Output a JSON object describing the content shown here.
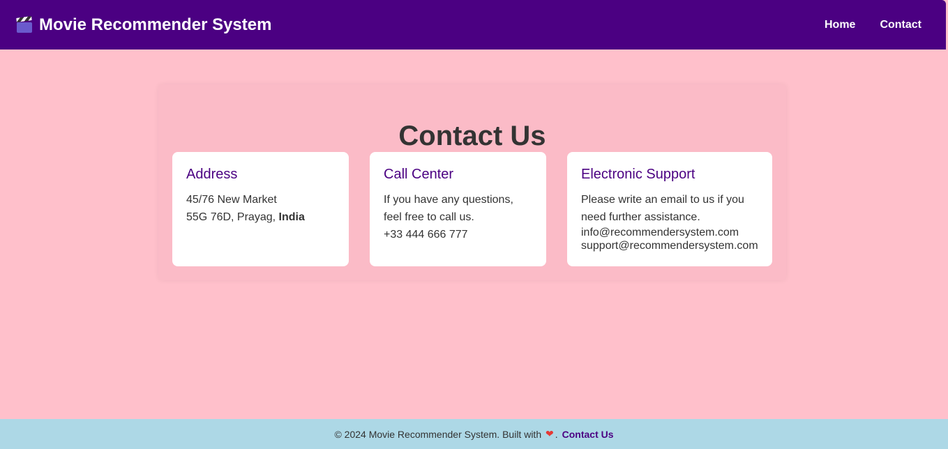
{
  "navbar": {
    "brand_icon": "clapperboard-icon",
    "title": "Movie Recommender System",
    "links": [
      "Home",
      "Contact"
    ]
  },
  "main": {
    "title": "Contact Us",
    "cards": [
      {
        "title": "Address",
        "line1": "45/76 New Market",
        "line2_prefix": "55G 76D, Prayag, ",
        "line2_bold": "India"
      },
      {
        "title": "Call Center",
        "text": "If you have any questions, feel free to call us.",
        "phone": "+33 444 666 777"
      },
      {
        "title": "Electronic Support",
        "text": "Please write an email to us if you need further assistance.",
        "emails": [
          "info@recommendersystem.com",
          "support@recommendersystem.com"
        ]
      }
    ]
  },
  "footer": {
    "text": "© 2024 Movie Recommender System. Built with",
    "heart_icon": "heart-icon",
    "separator": ".",
    "link": "Contact Us"
  },
  "colors": {
    "navbar_bg": "#4b0082",
    "page_bg": "#ffc0cb",
    "footer_bg": "#add8e6",
    "accent": "#4b0082"
  }
}
